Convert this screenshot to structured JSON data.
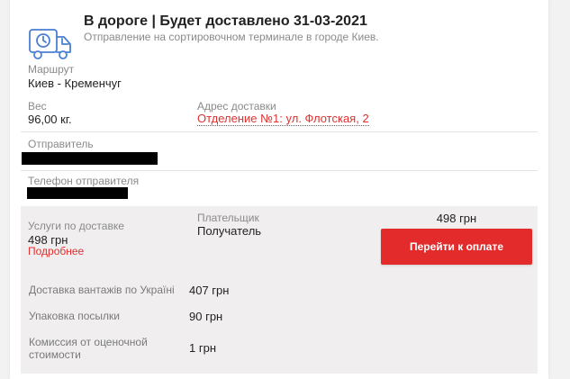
{
  "status": {
    "title": "В дороге | Будет доставлено 31-03-2021",
    "subtitle": "Отправление на сортировочном терминале в городе Киев.",
    "icon": "delivery-truck-clock-icon",
    "accent_color": "#4a7fd1"
  },
  "route": {
    "label": "Маршрут",
    "value": "Киев - Кременчуг"
  },
  "weight": {
    "label": "Вес",
    "value": "96,00 кг."
  },
  "delivery_address": {
    "label": "Адрес доставки",
    "value": "Отделение №1: ул. Флотская, 2"
  },
  "sender": {
    "label": "Отправитель"
  },
  "sender_phone": {
    "label": "Телефон отправителя"
  },
  "payment": {
    "services_label": "Услуги по доставке",
    "services_total": "498 грн",
    "details_link": "Подробнее",
    "payer_label": "Плательщик",
    "payer_value": "Получатель",
    "amount": "498 грн",
    "pay_button": "Перейти к оплате",
    "pay_button_color": "#e32b2b"
  },
  "services": [
    {
      "name": "Доставка вантажів по Україні",
      "price": "407 грн"
    },
    {
      "name": "Упаковка посылки",
      "price": "90 грн"
    },
    {
      "name": "Комиссия от оценочной стоимости",
      "price": "1 грн"
    }
  ]
}
